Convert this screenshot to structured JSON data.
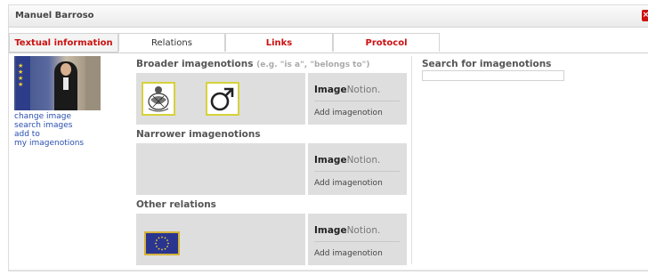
{
  "window": {
    "title": "Manuel Barroso",
    "close_icon": "close-icon"
  },
  "tabs": [
    {
      "label": "Textual information",
      "state": "active"
    },
    {
      "label": "Relations",
      "state": "selected"
    },
    {
      "label": "Links",
      "state": "normal"
    },
    {
      "label": "Protocol",
      "state": "normal"
    }
  ],
  "left": {
    "links": [
      "change image",
      "search images",
      "add to",
      "my imagenotions"
    ]
  },
  "sections": {
    "broader": {
      "heading": "Broader imagenotions",
      "hint": "(e.g. \"is a\", \"belongs to\")"
    },
    "narrower": {
      "heading": "Narrower imagenotions"
    },
    "other": {
      "heading": "Other relations"
    }
  },
  "brand": {
    "bold": "Image",
    "normal": "Notion."
  },
  "add_label": "Add imagenotion",
  "search": {
    "label": "Search for imagenotions",
    "value": "",
    "placeholder": ""
  },
  "colors": {
    "accent_red": "#cc1111",
    "link_blue": "#2a4fb0",
    "box_gray": "#dedede",
    "thumb_border": "#d6d23a"
  }
}
